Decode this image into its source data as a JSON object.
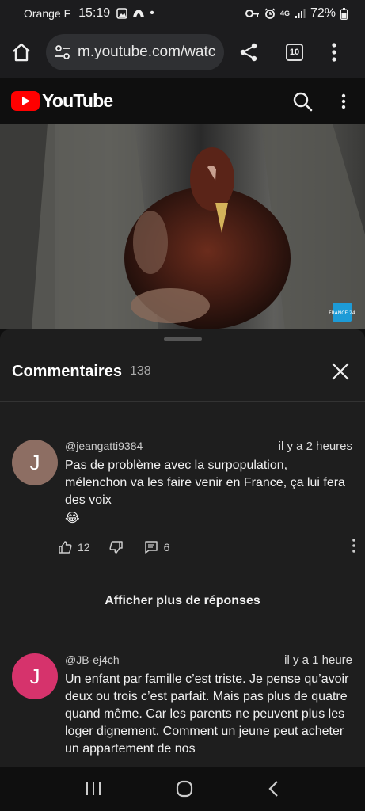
{
  "status_bar": {
    "carrier": "Orange F",
    "time": "15:19",
    "network": "4G",
    "battery": "72%"
  },
  "browser": {
    "url": "m.youtube.com/watc",
    "tab_count": "10"
  },
  "youtube": {
    "logo_text": "YouTube",
    "brand_color": "#ff0000"
  },
  "video": {
    "watermark": "FRANCE 24"
  },
  "comments": {
    "title": "Commentaires",
    "count": "138",
    "items": [
      {
        "avatar_letter": "J",
        "avatar_color": "#8d6e63",
        "author": "@jeangatti9384",
        "time": "il y a 2 heures",
        "text": "Pas de problème avec la surpopulation, mélenchon va les faire venir en France, ça lui fera des voix",
        "emoji": "😂",
        "likes": "12",
        "replies": "6"
      },
      {
        "avatar_letter": "J",
        "avatar_color": "#d6336c",
        "author": "@JB-ej4ch",
        "time": "il y a 1 heure",
        "text": "Un enfant par famille c’est triste. Je pense qu’avoir deux ou trois c’est parfait. Mais pas plus de quatre quand même. Car les parents ne peuvent plus les loger dignement. Comment un jeune peut acheter un appartement de nos"
      }
    ],
    "more_replies_label": "Afficher plus de réponses"
  }
}
